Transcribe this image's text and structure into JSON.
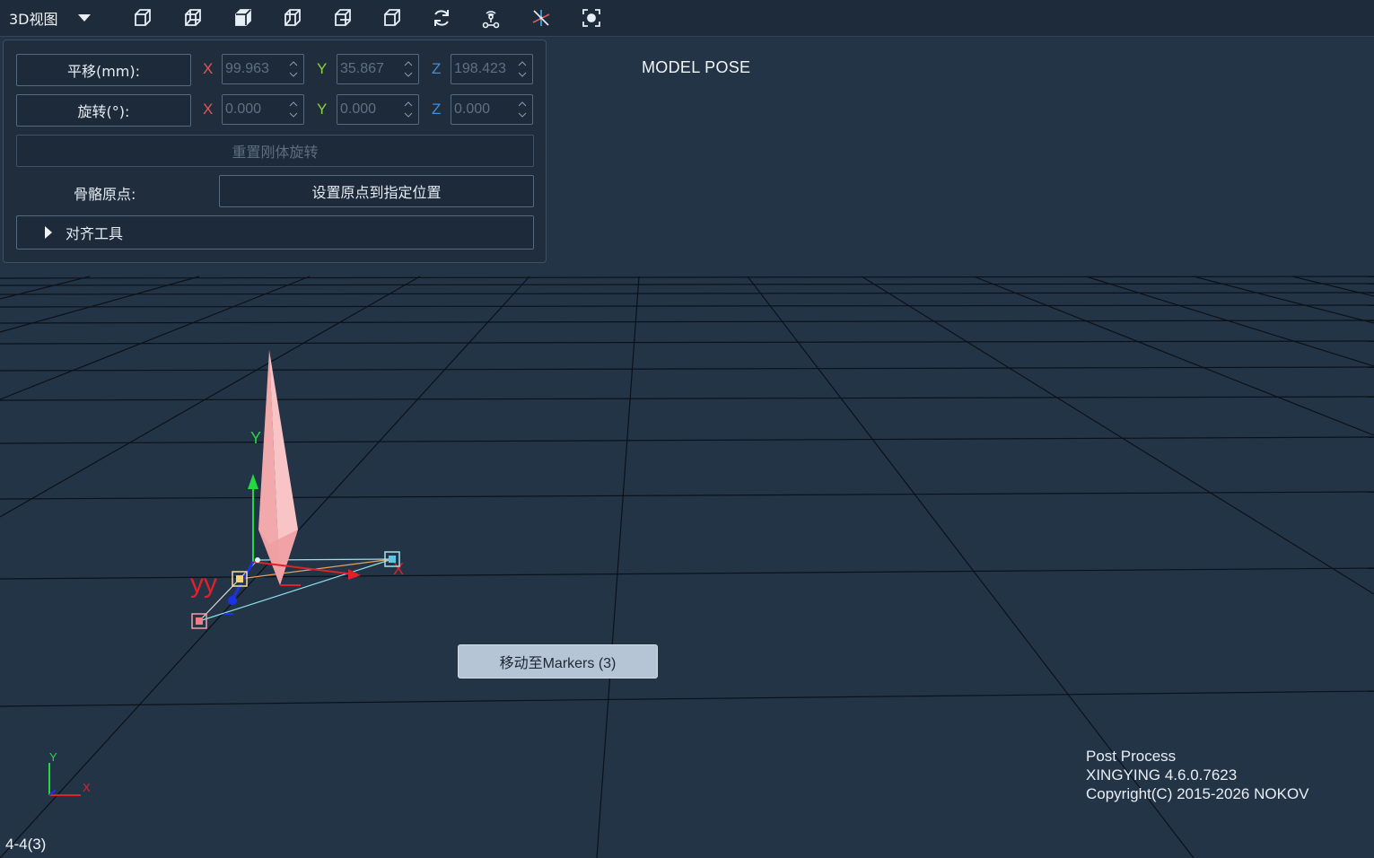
{
  "toolbar": {
    "view_label": "3D视图",
    "icons": [
      "cube-front-view-icon",
      "cube-top-view-icon",
      "cube-solid-view-icon",
      "cube-left-view-icon",
      "cube-right-view-icon",
      "cube-side-view-icon",
      "refresh-icon",
      "robot-icon",
      "axis-tool-icon",
      "focus-icon"
    ]
  },
  "panel": {
    "translate_label": "平移(mm):",
    "rotate_label": "旋转(°):",
    "translate": {
      "x": "99.963",
      "y": "35.867",
      "z": "198.423"
    },
    "rotate": {
      "x": "0.000",
      "y": "0.000",
      "z": "0.000"
    },
    "axis_labels": {
      "x": "X",
      "y": "Y",
      "z": "Z"
    },
    "reset_rotation_label": "重置刚体旋转",
    "origin_label": "骨骼原点:",
    "set_origin_label": "设置原点到指定位置",
    "align_tools_label": "对齐工具"
  },
  "viewport": {
    "mode_label": "MODEL POSE",
    "move_button_label": "移动至Markers (3)",
    "gizmo_labels": {
      "y": "Y",
      "x": "X",
      "bone": "yy"
    },
    "corner_axis": {
      "y": "Y",
      "x": "X"
    }
  },
  "info": {
    "line1": "Post Process",
    "line2": "XINGYING 4.6.0.7623",
    "line3": "Copyright(C) 2015-2026 NOKOV"
  },
  "status_text": "4-4(3)",
  "colors": {
    "background": "#243447",
    "grid": "#0b1118",
    "bone": "#f6b3b5"
  }
}
